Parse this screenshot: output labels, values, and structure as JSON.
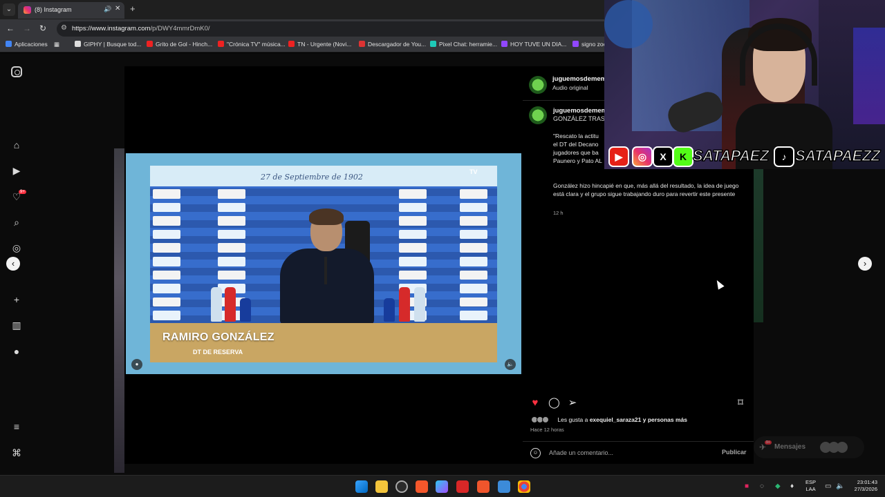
{
  "browser": {
    "tab_title": "(8) Instagram",
    "tab_audio_icon": "speaker-icon",
    "url_host": "https://www.instagram.com",
    "url_path": "/p/DWY4mmrDmK0/",
    "bookmarks": [
      "Aplicaciones",
      "GIPHY | Busque tod...",
      "Grito de Gol - Hinch...",
      "\"Crónica TV\" música...",
      "TN - Urgente (Novi...",
      "Descargador de You...",
      "Pixel Chat: herramie...",
      "HOY TUVE UN DIA...",
      "signo zoc"
    ]
  },
  "sidebar": {
    "notif_badge": "9+",
    "icons": [
      "instagram-logo-icon",
      "home-icon",
      "reels-icon",
      "heart-icon",
      "search-icon",
      "explore-icon",
      "create-icon",
      "dashboard-icon",
      "profile-icon",
      "menu-icon",
      "threads-icon"
    ]
  },
  "video": {
    "date_line": "27 de Septiembre de 1902",
    "tv_logo": "TV",
    "lower_name": "RAMIRO GONZÁLEZ",
    "lower_role": "DT DE RESERVA"
  },
  "post": {
    "username": "juguemosdemem",
    "audio": "Audio original",
    "caption_username": "juguemosdemem",
    "caption_title": "GONZÁLEZ TRAS",
    "caption_quote_lines": [
      "\"Rescato la actitu",
      "el DT del Decano",
      "jugadores que ba",
      "Paunero y Pato AL"
    ],
    "caption_body": "González hizo hincapié en que, más allá del resultado, la idea de juego está clara y el grupo sigue trabajando duro para revertir este presente",
    "caption_time": "12 h",
    "likes_prefix": "Les gusta a",
    "likes_user": "exequiel_saraza21",
    "likes_suffix": "y personas más",
    "posted_ago": "Hace 12 horas",
    "comment_placeholder": "Añade un comentario...",
    "publish_label": "Publicar",
    "liked_color": "#ff3040"
  },
  "messages": {
    "label": "Mensajes",
    "badge": "9+"
  },
  "overlay": {
    "handle_1": "SATAPAEZ",
    "handle_2": "SATAPAEZZ"
  },
  "taskbar": {
    "lang_1": "ESP",
    "lang_2": "LAA",
    "time": "23:01:43",
    "date": "27/3/2026"
  }
}
